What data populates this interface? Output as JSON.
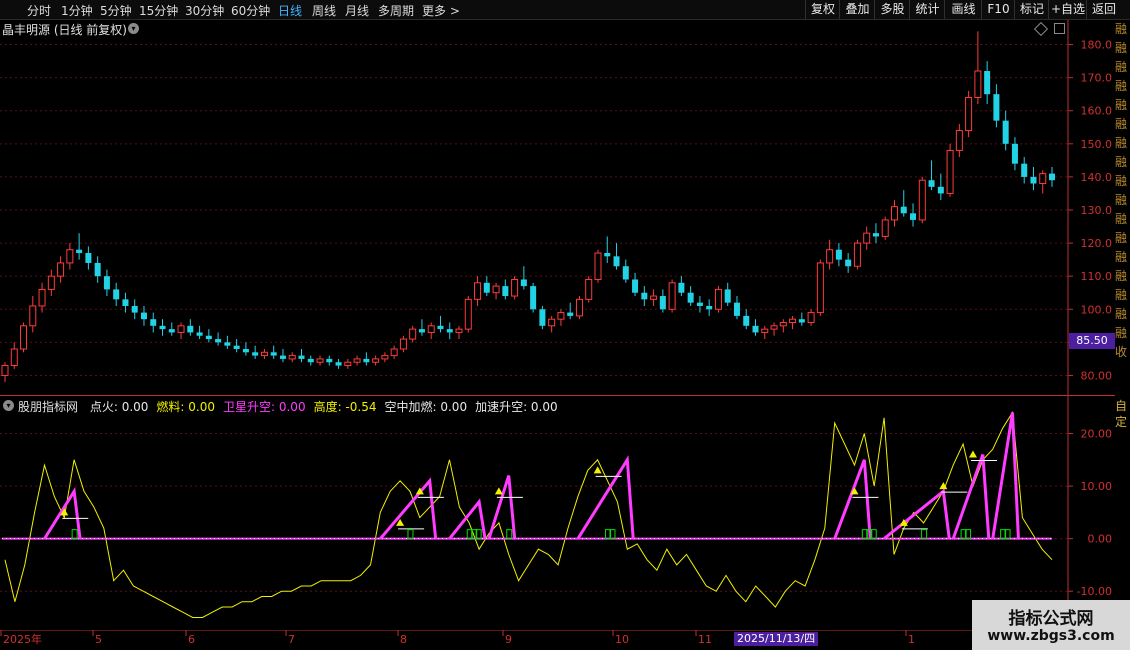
{
  "toolbar": {
    "periods": [
      "分时",
      "1分钟",
      "5分钟",
      "15分钟",
      "30分钟",
      "60分钟",
      "日线",
      "周线",
      "月线",
      "多周期",
      "更多 >"
    ],
    "active_period": "日线",
    "right_buttons": [
      "复权",
      "叠加",
      "多股",
      "统计",
      "画线",
      "F10",
      "标记",
      "+自选",
      "返回"
    ]
  },
  "main_chart": {
    "title": "晶丰明源 (日线 前复权)",
    "y_ticks": [
      "180.0",
      "170.0",
      "160.0",
      "150.0",
      "140.0",
      "130.0",
      "120.0",
      "110.0",
      "100.0",
      "90.00",
      "80.00"
    ],
    "current_price": "85.50"
  },
  "indicator": {
    "name": "股朋指标网",
    "readouts": [
      {
        "label": "点火:",
        "value": "0.00",
        "color": "#e8e8e8"
      },
      {
        "label": "燃料:",
        "value": "0.00",
        "color": "#f0f000"
      },
      {
        "label": "卫星升空:",
        "value": "0.00",
        "color": "#ff3cff"
      },
      {
        "label": "高度:",
        "value": "-0.54",
        "color": "#f0f000"
      },
      {
        "label": "空中加燃:",
        "value": "0.00",
        "color": "#e8e8e8"
      },
      {
        "label": "加速升空:",
        "value": "0.00",
        "color": "#e8e8e8"
      }
    ],
    "y_ticks": [
      "20.00",
      "10.00",
      "0.00",
      "-10.00"
    ]
  },
  "time_axis": {
    "labels": [
      "2025年",
      "5",
      "6",
      "7",
      "8",
      "9",
      "10",
      "11",
      "1"
    ],
    "highlight_date": "2025/11/13/四"
  },
  "colors": {
    "up": "#ff3b3b",
    "down": "#22d3e6",
    "yellow_line": "#f0f000",
    "magenta_line": "#ff3cff",
    "axis_red": "#c03030",
    "grid": "#5a1010",
    "green_box": "#00e000"
  },
  "side_strip": {
    "top_chars": [
      "融",
      "融",
      "融",
      "融",
      "融",
      "融",
      "融",
      "融",
      "融",
      "融",
      "融",
      "融",
      "融",
      "融",
      "融",
      "融",
      "融",
      "收"
    ],
    "bottom_chars": [
      "自",
      "定"
    ]
  },
  "watermark": {
    "title": "指标公式网",
    "url": "www.zbgs3.com"
  },
  "chart_data": {
    "type": "candlestick",
    "candles": [
      [
        80,
        84,
        78,
        83
      ],
      [
        83,
        90,
        82,
        88
      ],
      [
        88,
        96,
        87,
        95
      ],
      [
        95,
        104,
        93,
        101
      ],
      [
        101,
        108,
        99,
        106
      ],
      [
        106,
        112,
        104,
        110
      ],
      [
        110,
        116,
        108,
        114
      ],
      [
        114,
        120,
        112,
        118
      ],
      [
        118,
        123,
        115,
        117
      ],
      [
        117,
        119,
        112,
        114
      ],
      [
        114,
        116,
        108,
        110
      ],
      [
        110,
        112,
        104,
        106
      ],
      [
        106,
        108,
        101,
        103
      ],
      [
        103,
        105,
        99,
        101
      ],
      [
        101,
        103,
        97,
        99
      ],
      [
        99,
        101,
        95,
        97
      ],
      [
        97,
        99,
        93,
        95
      ],
      [
        95,
        97,
        92,
        94
      ],
      [
        94,
        96,
        92,
        93
      ],
      [
        93,
        96,
        91,
        95
      ],
      [
        95,
        97,
        92,
        93
      ],
      [
        93,
        95,
        91,
        92
      ],
      [
        92,
        94,
        90,
        91
      ],
      [
        91,
        93,
        89,
        90
      ],
      [
        90,
        92,
        88,
        89
      ],
      [
        89,
        91,
        87,
        88
      ],
      [
        88,
        90,
        86,
        87
      ],
      [
        87,
        89,
        85,
        86
      ],
      [
        86,
        88,
        85,
        87
      ],
      [
        87,
        89,
        85,
        86
      ],
      [
        86,
        88,
        84,
        85
      ],
      [
        85,
        87,
        84,
        86
      ],
      [
        86,
        88,
        84,
        85
      ],
      [
        85,
        86,
        83,
        84
      ],
      [
        84,
        86,
        83,
        85
      ],
      [
        85,
        86,
        83,
        84
      ],
      [
        84,
        85,
        82,
        83
      ],
      [
        83,
        85,
        82,
        84
      ],
      [
        84,
        86,
        83,
        85
      ],
      [
        85,
        87,
        83,
        84
      ],
      [
        84,
        86,
        83,
        85
      ],
      [
        85,
        87,
        84,
        86
      ],
      [
        86,
        89,
        85,
        88
      ],
      [
        88,
        92,
        87,
        91
      ],
      [
        91,
        95,
        90,
        94
      ],
      [
        94,
        97,
        92,
        93
      ],
      [
        93,
        96,
        91,
        95
      ],
      [
        95,
        98,
        93,
        94
      ],
      [
        94,
        96,
        91,
        93
      ],
      [
        93,
        95,
        91,
        94
      ],
      [
        94,
        104,
        93,
        103
      ],
      [
        103,
        110,
        101,
        108
      ],
      [
        108,
        110,
        104,
        105
      ],
      [
        105,
        108,
        103,
        107
      ],
      [
        107,
        109,
        103,
        104
      ],
      [
        104,
        110,
        103,
        109
      ],
      [
        109,
        113,
        106,
        107
      ],
      [
        107,
        108,
        99,
        100
      ],
      [
        100,
        101,
        94,
        95
      ],
      [
        95,
        98,
        93,
        97
      ],
      [
        97,
        100,
        95,
        99
      ],
      [
        99,
        102,
        97,
        98
      ],
      [
        98,
        104,
        97,
        103
      ],
      [
        103,
        110,
        102,
        109
      ],
      [
        109,
        118,
        108,
        117
      ],
      [
        117,
        122,
        114,
        116
      ],
      [
        116,
        120,
        112,
        113
      ],
      [
        113,
        115,
        108,
        109
      ],
      [
        109,
        111,
        104,
        105
      ],
      [
        105,
        107,
        101,
        103
      ],
      [
        103,
        106,
        101,
        104
      ],
      [
        104,
        106,
        99,
        100
      ],
      [
        100,
        109,
        99,
        108
      ],
      [
        108,
        110,
        104,
        105
      ],
      [
        105,
        107,
        101,
        102
      ],
      [
        102,
        104,
        99,
        101
      ],
      [
        101,
        103,
        98,
        100
      ],
      [
        100,
        107,
        99,
        106
      ],
      [
        106,
        108,
        101,
        102
      ],
      [
        102,
        104,
        97,
        98
      ],
      [
        98,
        100,
        94,
        95
      ],
      [
        95,
        97,
        92,
        93
      ],
      [
        93,
        95,
        91,
        94
      ],
      [
        94,
        96,
        92,
        95
      ],
      [
        95,
        97,
        93,
        96
      ],
      [
        96,
        98,
        94,
        97
      ],
      [
        97,
        99,
        95,
        96
      ],
      [
        96,
        100,
        95,
        99
      ],
      [
        99,
        115,
        98,
        114
      ],
      [
        114,
        121,
        112,
        118
      ],
      [
        118,
        120,
        113,
        115
      ],
      [
        115,
        117,
        111,
        113
      ],
      [
        113,
        121,
        112,
        120
      ],
      [
        120,
        125,
        118,
        123
      ],
      [
        123,
        126,
        120,
        122
      ],
      [
        122,
        128,
        121,
        127
      ],
      [
        127,
        133,
        125,
        131
      ],
      [
        131,
        136,
        128,
        129
      ],
      [
        129,
        132,
        125,
        127
      ],
      [
        127,
        140,
        126,
        139
      ],
      [
        139,
        145,
        136,
        137
      ],
      [
        137,
        141,
        133,
        135
      ],
      [
        135,
        150,
        134,
        148
      ],
      [
        148,
        156,
        146,
        154
      ],
      [
        154,
        166,
        152,
        164
      ],
      [
        164,
        184,
        162,
        172
      ],
      [
        172,
        175,
        162,
        165
      ],
      [
        165,
        168,
        155,
        157
      ],
      [
        157,
        160,
        148,
        150
      ],
      [
        150,
        152,
        142,
        144
      ],
      [
        144,
        146,
        138,
        140
      ],
      [
        140,
        143,
        136,
        138
      ],
      [
        138,
        142,
        135,
        141
      ],
      [
        141,
        143,
        137,
        139
      ]
    ],
    "ylim": [
      75,
      185
    ],
    "indicator_ylim": [
      -17,
      26
    ]
  }
}
